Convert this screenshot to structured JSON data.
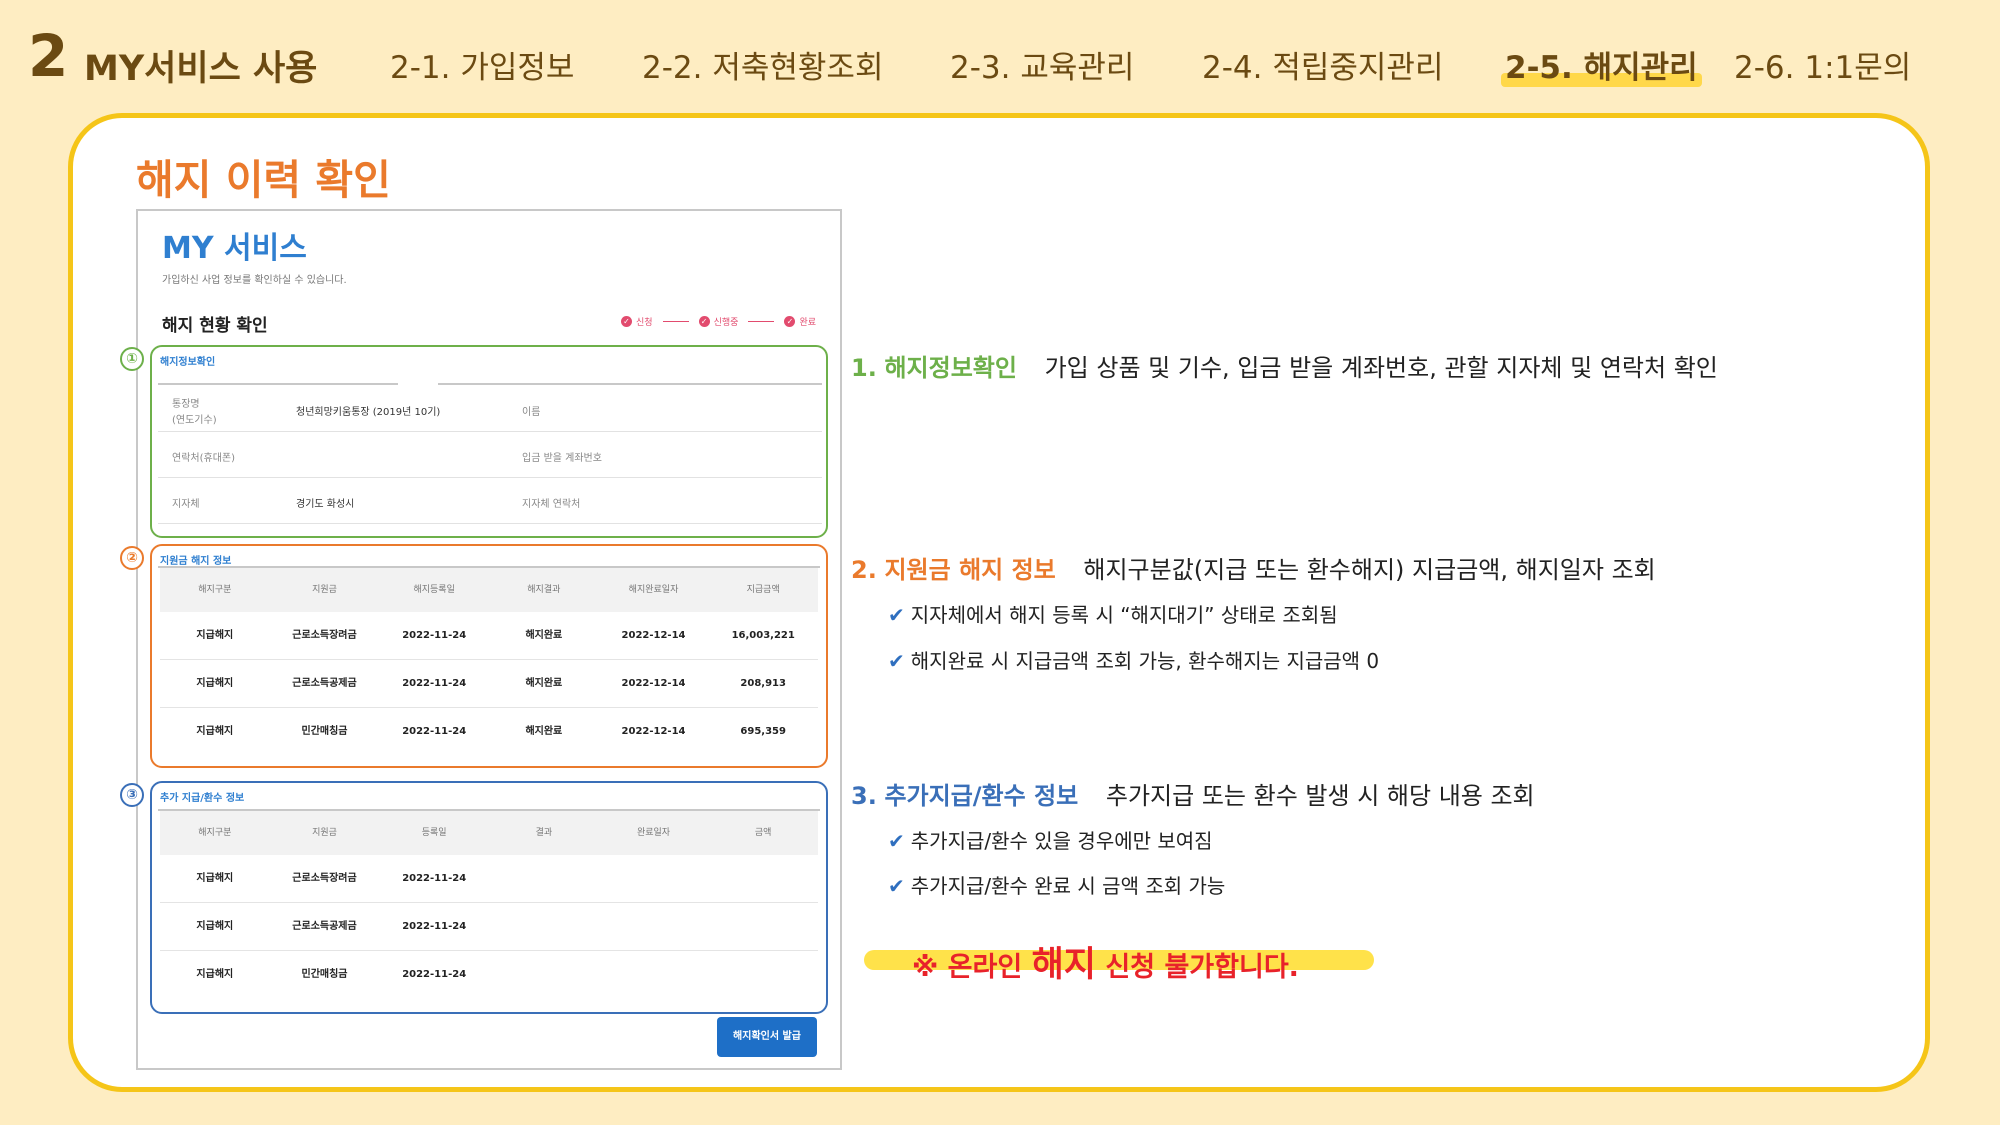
{
  "nav": {
    "section_number": "2",
    "section_title": "MY서비스 사용",
    "tabs": [
      {
        "label": "2-1. 가입정보"
      },
      {
        "label": "2-2. 저축현황조회"
      },
      {
        "label": "2-3. 교육관리"
      },
      {
        "label": "2-4. 적립중지관리"
      },
      {
        "label": "2-5. 해지관리",
        "active": true
      },
      {
        "label": "2-6. 1:1문의"
      }
    ]
  },
  "panel": {
    "title": "해지 이력 확인"
  },
  "screenshot": {
    "title": "MY 서비스",
    "desc": "가입하신 사업 정보를 확인하실 수 있습니다.",
    "status_title": "해지 현황 확인",
    "steps": [
      "신청",
      "신행중",
      "완료"
    ],
    "box1": {
      "marker": "①",
      "label": "해지정보확인",
      "fields": [
        {
          "label": "통장명",
          "label2": "(연도기수)",
          "value": "청년희망키움통장 (2019년 10기)"
        },
        {
          "label": "이름",
          "value": ""
        },
        {
          "label": "연락처(휴대폰)",
          "value": ""
        },
        {
          "label": "입금 받을 계좌번호",
          "value": ""
        },
        {
          "label": "지자체",
          "value": "경기도 화성시"
        },
        {
          "label": "지자체 연락처",
          "value": ""
        }
      ]
    },
    "box2": {
      "marker": "②",
      "label": "지원금 해지 정보",
      "headers": [
        "해지구분",
        "지원금",
        "해지등록일",
        "해지결과",
        "해지완료일자",
        "지급금액"
      ],
      "rows": [
        [
          "지급해지",
          "근로소득장려금",
          "2022-11-24",
          "해지완료",
          "2022-12-14",
          "16,003,221"
        ],
        [
          "지급해지",
          "근로소득공제금",
          "2022-11-24",
          "해지완료",
          "2022-12-14",
          "208,913"
        ],
        [
          "지급해지",
          "민간매칭금",
          "2022-11-24",
          "해지완료",
          "2022-12-14",
          "695,359"
        ]
      ]
    },
    "box3": {
      "marker": "③",
      "label": "추가 지급/환수 정보",
      "headers": [
        "해지구분",
        "지원금",
        "등록일",
        "결과",
        "완료일자",
        "금액"
      ],
      "rows": [
        [
          "지급해지",
          "근로소득장려금",
          "2022-11-24",
          "",
          "",
          ""
        ],
        [
          "지급해지",
          "근로소득공제금",
          "2022-11-24",
          "",
          "",
          ""
        ],
        [
          "지급해지",
          "민간매칭금",
          "2022-11-24",
          "",
          "",
          ""
        ]
      ]
    },
    "issue_button": "해지확인서 발급"
  },
  "descriptions": [
    {
      "num": "1.",
      "key": "해지정보확인",
      "value": "가입 상품 및 기수, 입금 받을 계좌번호, 관할 지자체 및 연락처 확인",
      "color": "#6DB04A",
      "subs": []
    },
    {
      "num": "2.",
      "key": "지원금 해지 정보",
      "value": "해지구분값(지급 또는 환수해지) 지급금액, 해지일자 조회",
      "color": "#EA7A2C",
      "subs": [
        "지자체에서 해지 등록 시 “해지대기” 상태로 조회됨",
        "해지완료 시 지급금액 조회 가능, 환수해지는 지급금액 0"
      ]
    },
    {
      "num": "3.",
      "key": "추가지급/환수 정보",
      "value": "추가지급 또는 환수 발생 시 해당 내용 조회",
      "color": "#3A6FB8",
      "subs": [
        "추가지급/환수 있을 경우에만 보여짐",
        "추가지급/환수 완료 시 금액 조회 가능"
      ]
    }
  ],
  "check_mark": "✔",
  "notice": {
    "prefix": "※ 온라인 ",
    "emphasis": "해지",
    "suffix": " 신청 불가합니다."
  },
  "colors": {
    "background": "#FEEDC2",
    "panel_border": "#F5C518",
    "title_orange": "#EA7A2C",
    "nav_brown": "#6B4A12",
    "accent_blue": "#2F7FD0",
    "notice_red": "#E8222A"
  }
}
